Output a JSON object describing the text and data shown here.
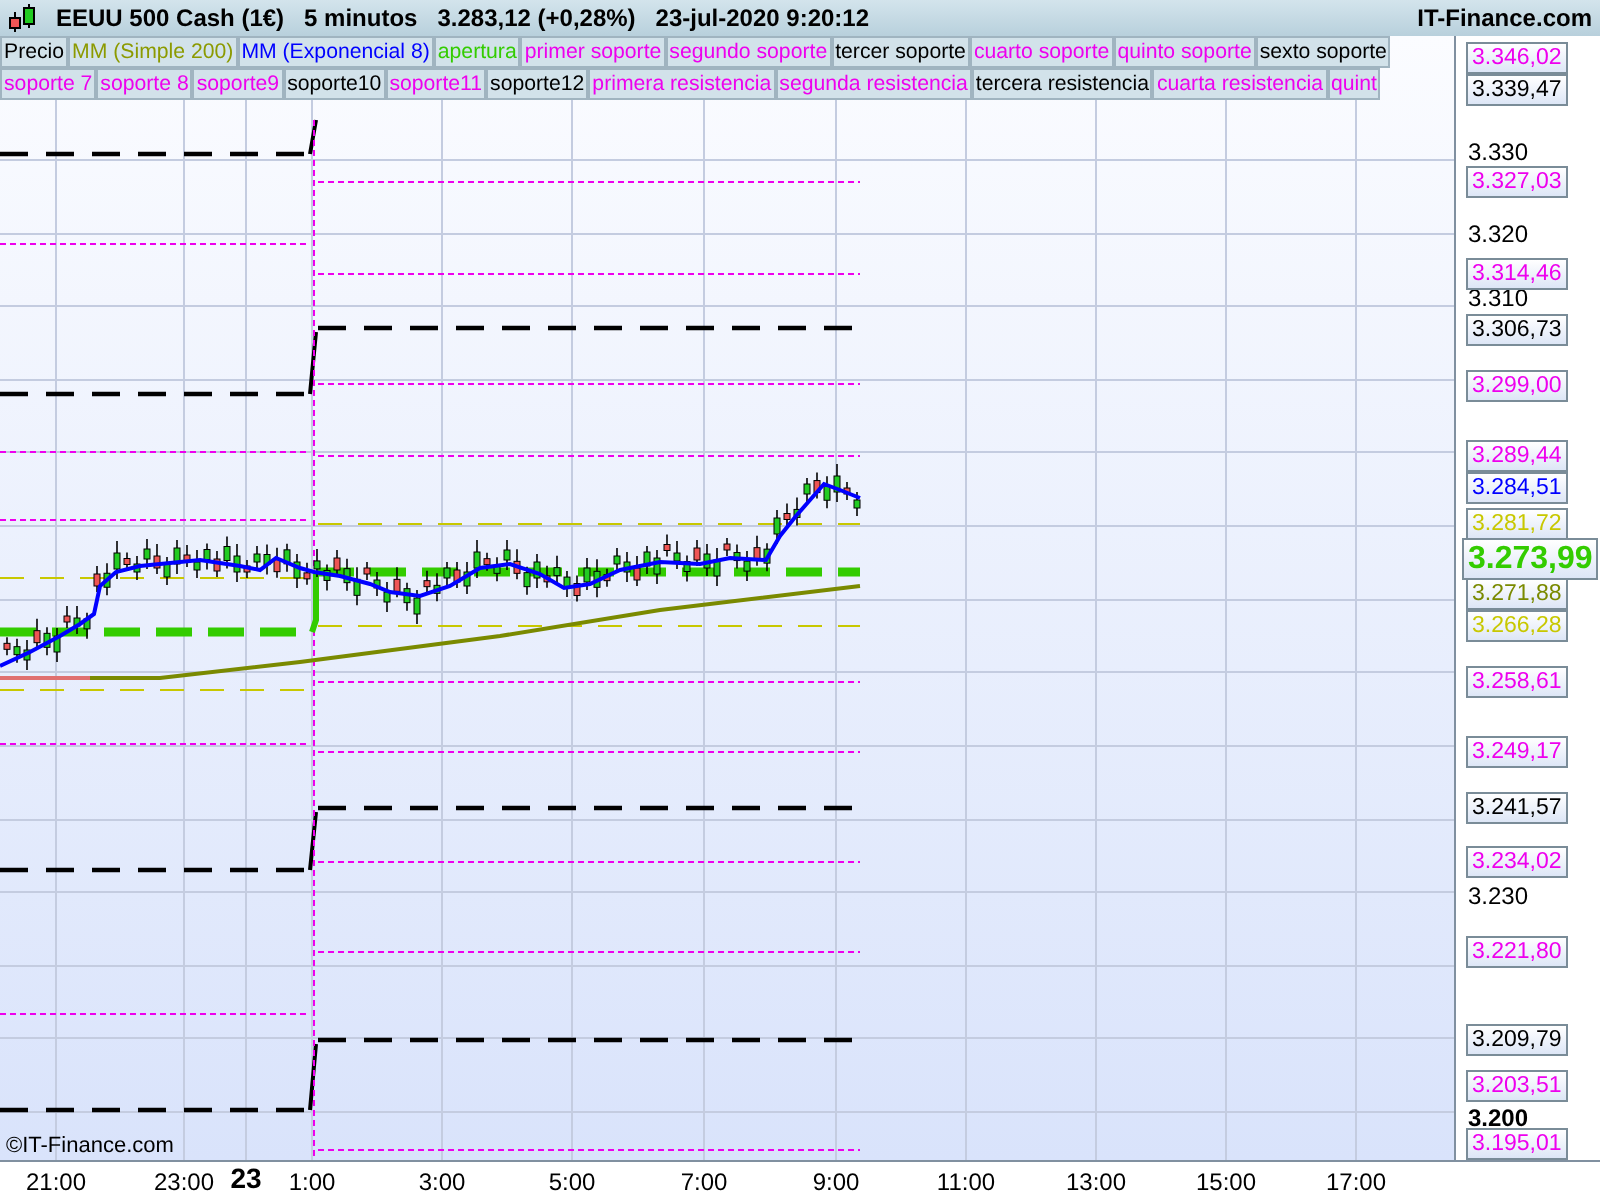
{
  "header": {
    "title": "EEUU 500 Cash (1€)",
    "interval": "5 minutos",
    "price": "3.283,12 (+0,28%)",
    "datetime": "23-jul-2020 9:20:12",
    "brand": "IT-Finance.com"
  },
  "legend": [
    [
      {
        "label": "Precio",
        "color": "#000000"
      },
      {
        "label": "MM (Simple 200)",
        "color": "#8c9a00"
      },
      {
        "label": "MM (Exponencial 8)",
        "color": "#0000ff"
      },
      {
        "label": "apertura",
        "color": "#33cc00"
      },
      {
        "label": "primer soporte",
        "color": "#ee00ee"
      },
      {
        "label": "segundo soporte",
        "color": "#ee00ee"
      },
      {
        "label": "tercer soporte",
        "color": "#000000"
      },
      {
        "label": "cuarto soporte",
        "color": "#ee00ee"
      },
      {
        "label": "quinto soporte",
        "color": "#ee00ee"
      },
      {
        "label": "sexto soporte",
        "color": "#000000"
      }
    ],
    [
      {
        "label": "soporte 7",
        "color": "#ee00ee"
      },
      {
        "label": "soporte 8",
        "color": "#ee00ee"
      },
      {
        "label": "soporte9",
        "color": "#ee00ee"
      },
      {
        "label": "soporte10",
        "color": "#000000"
      },
      {
        "label": "soporte11",
        "color": "#ee00ee"
      },
      {
        "label": "soporte12",
        "color": "#000000"
      },
      {
        "label": "primera resistencia",
        "color": "#ee00ee"
      },
      {
        "label": "segunda resistencia",
        "color": "#ee00ee"
      },
      {
        "label": "tercera resistencia",
        "color": "#000000"
      },
      {
        "label": "cuarta resistencia",
        "color": "#ee00ee"
      },
      {
        "label": "quint",
        "color": "#ee00ee"
      }
    ]
  ],
  "chart_credit": "©IT-Finance.com",
  "price_axis": {
    "ticks": [
      {
        "label": "3.330",
        "bold": false
      },
      {
        "label": "3.320",
        "bold": false
      },
      {
        "label": "3.310",
        "bold": false
      },
      {
        "label": "3.230",
        "bold": false
      },
      {
        "label": "3.200",
        "bold": true
      }
    ],
    "tags": [
      {
        "label": "3.346,02",
        "color": "#ee00ee",
        "current": false
      },
      {
        "label": "3.339,47",
        "color": "#000000",
        "current": false
      },
      {
        "label": "3.327,03",
        "color": "#ee00ee",
        "current": false
      },
      {
        "label": "3.314,46",
        "color": "#ee00ee",
        "current": false
      },
      {
        "label": "3.306,73",
        "color": "#000000",
        "current": false
      },
      {
        "label": "3.299,00",
        "color": "#ee00ee",
        "current": false
      },
      {
        "label": "3.289,44",
        "color": "#ee00ee",
        "current": false
      },
      {
        "label": "3.284,51",
        "color": "#0000ff",
        "current": false
      },
      {
        "label": "3.281,72",
        "color": "#c8c800",
        "current": false
      },
      {
        "label": "3.273,99",
        "color": "#33cc00",
        "current": true
      },
      {
        "label": "3.271,88",
        "color": "#7a8a00",
        "current": false
      },
      {
        "label": "3.266,28",
        "color": "#c8c800",
        "current": false
      },
      {
        "label": "3.258,61",
        "color": "#ee00ee",
        "current": false
      },
      {
        "label": "3.249,17",
        "color": "#ee00ee",
        "current": false
      },
      {
        "label": "3.241,57",
        "color": "#000000",
        "current": false
      },
      {
        "label": "3.234,02",
        "color": "#ee00ee",
        "current": false
      },
      {
        "label": "3.221,80",
        "color": "#ee00ee",
        "current": false
      },
      {
        "label": "3.209,79",
        "color": "#000000",
        "current": false
      },
      {
        "label": "3.203,51",
        "color": "#ee00ee",
        "current": false
      },
      {
        "label": "3.195,01",
        "color": "#ee00ee",
        "current": false
      }
    ]
  },
  "time_axis": [
    {
      "label": "21:00",
      "bold": false
    },
    {
      "label": "23:00",
      "bold": false
    },
    {
      "label": "23",
      "bold": true
    },
    {
      "label": "1:00",
      "bold": false
    },
    {
      "label": "3:00",
      "bold": false
    },
    {
      "label": "5:00",
      "bold": false
    },
    {
      "label": "7:00",
      "bold": false
    },
    {
      "label": "9:00",
      "bold": false
    },
    {
      "label": "11:00",
      "bold": false
    },
    {
      "label": "13:00",
      "bold": false
    },
    {
      "label": "15:00",
      "bold": false
    },
    {
      "label": "17:00",
      "bold": false
    }
  ]
}
